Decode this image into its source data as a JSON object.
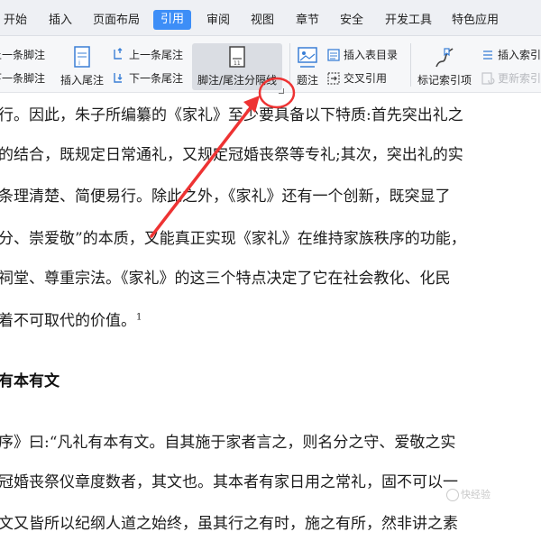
{
  "tabs": [
    {
      "label": "开始"
    },
    {
      "label": "插入"
    },
    {
      "label": "页面布局"
    },
    {
      "label": "引用",
      "active": true
    },
    {
      "label": "审阅"
    },
    {
      "label": "视图"
    },
    {
      "label": "章节"
    },
    {
      "label": "安全"
    },
    {
      "label": "开发工具"
    },
    {
      "label": "特色应用"
    }
  ],
  "ribbon": {
    "prev_footnote": "上一条脚注",
    "next_footnote": "下一条脚注",
    "insert_endnote": "插入尾注",
    "prev_endnote": "上一条尾注",
    "next_endnote": "下一条尾注",
    "footnote_separator": "脚注/尾注分隔线",
    "caption": "题注",
    "insert_table_of_figures": "插入表目录",
    "cross_reference": "交叉引用",
    "mark_index_entry": "标记索引项",
    "insert_index": "插入索引",
    "update_index": "更新索引"
  },
  "document": {
    "lines": [
      "行。因此，朱子所编纂的《家礼》至少要具备以下特质:首先突出礼之",
      "的结合，既规定日常通礼，又规定冠婚丧祭等专礼;其次，突出礼的实",
      "条理清楚、简便易行。除此之外，《家礼》还有一个创新，既突显了",
      "分、崇爱敬”的本质，又能真正实现《家礼》在维持家族秩序的功能，",
      "祠堂、尊重宗法。《家礼》的这三个特点决定了它在社会教化、化民",
      "着不可取代的价值。"
    ],
    "footnote_ref": "1",
    "heading": "有本有文",
    "lines2": [
      "序》曰:“凡礼有本有文。自其施于家者言之，则名分之守、爱敬之实",
      "冠婚丧祭仪章度数者，其文也。其本者有家日用之常礼，固不可以一",
      "文又皆所以纪纲人道之始终，虽其行之有时，施之有所，然非讲之素"
    ]
  },
  "watermark": "快经验",
  "colors": {
    "active_tab": "#3d8ef7",
    "arrow": "#ee3333"
  }
}
